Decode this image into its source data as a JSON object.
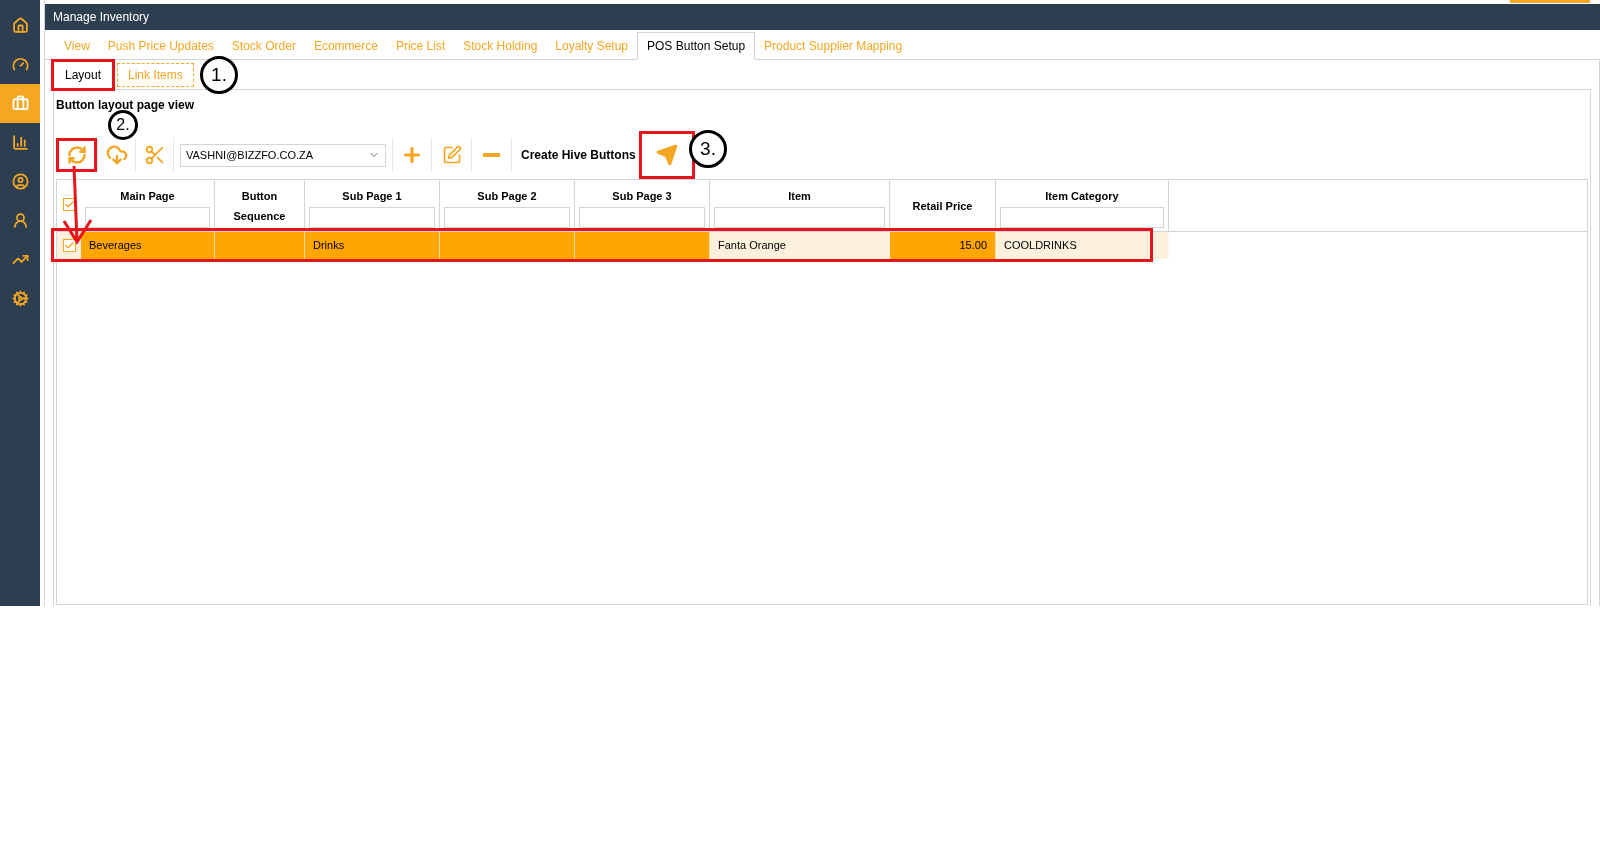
{
  "sidebar": {
    "items": [
      {
        "selected": false
      },
      {
        "selected": false
      },
      {
        "selected": true
      },
      {
        "selected": false
      },
      {
        "selected": false
      },
      {
        "selected": false
      },
      {
        "selected": false
      },
      {
        "selected": false
      }
    ]
  },
  "window": {
    "title": "Manage Inventory"
  },
  "tabs": [
    {
      "label": "View",
      "selected": false
    },
    {
      "label": "Push Price Updates",
      "selected": false
    },
    {
      "label": "Stock Order",
      "selected": false
    },
    {
      "label": "Ecommerce",
      "selected": false
    },
    {
      "label": "Price List",
      "selected": false
    },
    {
      "label": "Stock Holding",
      "selected": false
    },
    {
      "label": "Loyalty Setup",
      "selected": false
    },
    {
      "label": "POS Button Setup",
      "selected": true
    },
    {
      "label": "Product Supplier Mapping",
      "selected": false
    }
  ],
  "subtabs": [
    {
      "label": "Layout",
      "selected": true
    },
    {
      "label": "Link Items",
      "selected": false
    }
  ],
  "section_title": "Button layout page view",
  "toolbar": {
    "user_select": {
      "value": "VASHNI@BIZZFO.CO.ZA"
    },
    "create_label": "Create Hive Buttons"
  },
  "table": {
    "select_all_checked": true,
    "columns": [
      {
        "label": "Main Page",
        "filter": true
      },
      {
        "label": "Button Sequence",
        "filter": false
      },
      {
        "label": "Sub Page 1",
        "filter": true
      },
      {
        "label": "Sub Page 2",
        "filter": true
      },
      {
        "label": "Sub Page 3",
        "filter": true
      },
      {
        "label": "Item",
        "filter": true
      },
      {
        "label": "Retail Price",
        "filter": false
      },
      {
        "label": "Item Category",
        "filter": true
      }
    ],
    "rows": [
      {
        "checked": true,
        "cells": [
          {
            "text": "Beverages",
            "highlighted": true
          },
          {
            "highlighted": true
          },
          {
            "text": "Drinks",
            "highlighted": true
          },
          {
            "highlighted": true
          },
          {
            "highlighted": true
          },
          {
            "text": "Fanta Orange",
            "highlighted": false
          },
          {
            "text": "15.00",
            "highlighted": true
          },
          {
            "text": "COOLDRINKS",
            "highlighted": false
          }
        ]
      }
    ]
  },
  "annotations": [
    {
      "kind": "step",
      "text": "1."
    },
    {
      "kind": "step",
      "text": "2."
    },
    {
      "kind": "step",
      "text": "3."
    }
  ]
}
